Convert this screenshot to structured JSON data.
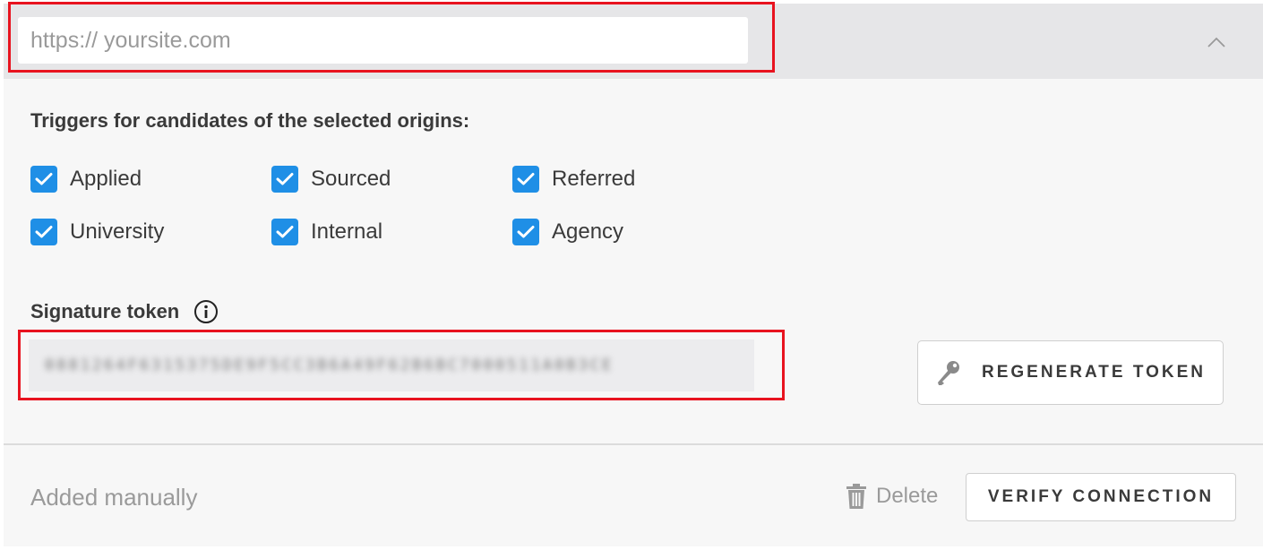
{
  "header": {
    "url_placeholder": "https:// yoursite.com",
    "collapse_icon": "chevron-up-icon"
  },
  "triggers": {
    "title": "Triggers for candidates of the selected origins:",
    "options": [
      {
        "label": "Applied",
        "checked": true
      },
      {
        "label": "Sourced",
        "checked": true
      },
      {
        "label": "Referred",
        "checked": true
      },
      {
        "label": "University",
        "checked": true
      },
      {
        "label": "Internal",
        "checked": true
      },
      {
        "label": "Agency",
        "checked": true
      }
    ],
    "checkbox_color": "#1f8fe6"
  },
  "signature": {
    "title": "Signature token",
    "info_icon": "info-icon",
    "token_value": "0881264F6315375DE9F5CC3B6A49F62B6BC7000511A0B3CE",
    "token_blurred": true,
    "regenerate_label": "REGENERATE TOKEN",
    "regenerate_icon": "key-icon"
  },
  "footer": {
    "added_text": "Added manually",
    "delete_label": "Delete",
    "delete_icon": "trash-icon",
    "verify_label": "VERIFY CONNECTION"
  },
  "colors": {
    "highlight": "#e8131f",
    "header_bg": "#e6e6e8",
    "panel_bg": "#f7f7f7"
  }
}
